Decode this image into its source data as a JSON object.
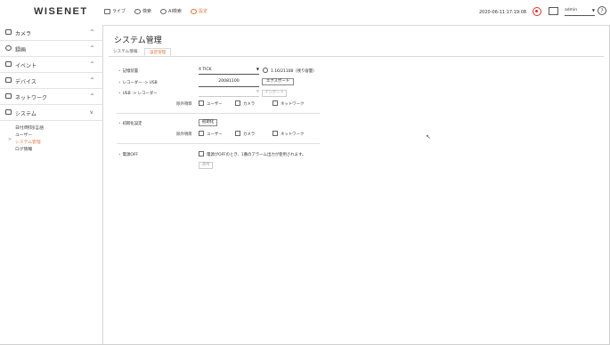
{
  "header": {
    "logo": "WISENET",
    "nav": [
      {
        "label": "ライブ",
        "icon": "monitor-icon"
      },
      {
        "label": "検索",
        "icon": "search-icon"
      },
      {
        "label": "AI検索",
        "icon": "ai-search-icon"
      },
      {
        "label": "設定",
        "icon": "settings-icon"
      }
    ],
    "datetime": "2020-06-11 17:19:08",
    "user": "admin",
    "help": "?"
  },
  "sidebar": {
    "menus": [
      {
        "label": "カメラ",
        "icon": "camera-icon",
        "chevron": "^"
      },
      {
        "label": "録画",
        "icon": "record-icon",
        "chevron": "^"
      },
      {
        "label": "イベント",
        "icon": "event-icon",
        "chevron": "^"
      },
      {
        "label": "デバイス",
        "icon": "device-icon",
        "chevron": "^"
      },
      {
        "label": "ネットワーク",
        "icon": "network-icon",
        "chevron": "^"
      },
      {
        "label": "システム",
        "icon": "system-icon",
        "chevron": "v"
      }
    ],
    "system_items": [
      "日付/時刻/言語",
      "ユーザー",
      "システム管理",
      "ログ情報"
    ]
  },
  "main": {
    "title": "システム管理",
    "tabs": [
      "システム情報",
      "設定管理"
    ],
    "storage_label": "記憶装置",
    "storage_value": "X TICK",
    "storage_capacity": "1.16/21108（残り容量）",
    "recorder_to_usb_label": "レコーダー -> USB",
    "export_filename": "20081100",
    "export_button": "エクスポート",
    "usb_to_recorder_label": "USB -> レコーダー",
    "import_button": "インポート",
    "exclude_label": "除外項目",
    "exclude_options": [
      "ユーザー",
      "カメラ",
      "ネットワーク"
    ],
    "init_label": "初期化設定",
    "init_button": "初期化",
    "power_label": "電源OFF",
    "power_desc": "電源がOFFのとき、1番のアラーム出力が使用されます。",
    "apply_button": "適用"
  }
}
